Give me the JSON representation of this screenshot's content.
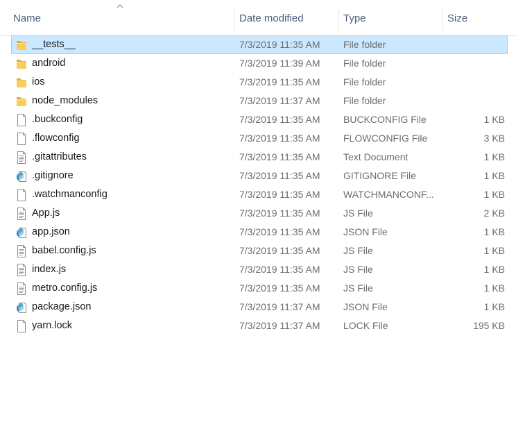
{
  "columns": {
    "name": "Name",
    "date": "Date modified",
    "type": "Type",
    "size": "Size"
  },
  "files": [
    {
      "name": "__tests__",
      "date": "7/3/2019 11:35 AM",
      "type": "File folder",
      "size": "",
      "icon": "folder-icon",
      "selected": true
    },
    {
      "name": "android",
      "date": "7/3/2019 11:39 AM",
      "type": "File folder",
      "size": "",
      "icon": "folder-icon"
    },
    {
      "name": "ios",
      "date": "7/3/2019 11:35 AM",
      "type": "File folder",
      "size": "",
      "icon": "folder-icon"
    },
    {
      "name": "node_modules",
      "date": "7/3/2019 11:37 AM",
      "type": "File folder",
      "size": "",
      "icon": "folder-icon"
    },
    {
      "name": ".buckconfig",
      "date": "7/3/2019 11:35 AM",
      "type": "BUCKCONFIG File",
      "size": "1 KB",
      "icon": "blank-file-icon"
    },
    {
      "name": ".flowconfig",
      "date": "7/3/2019 11:35 AM",
      "type": "FLOWCONFIG File",
      "size": "3 KB",
      "icon": "blank-file-icon"
    },
    {
      "name": ".gitattributes",
      "date": "7/3/2019 11:35 AM",
      "type": "Text Document",
      "size": "1 KB",
      "icon": "text-file-icon"
    },
    {
      "name": ".gitignore",
      "date": "7/3/2019 11:35 AM",
      "type": "GITIGNORE File",
      "size": "1 KB",
      "icon": "editor-file-icon"
    },
    {
      "name": ".watchmanconfig",
      "date": "7/3/2019 11:35 AM",
      "type": "WATCHMANCONF...",
      "size": "1 KB",
      "icon": "blank-file-icon"
    },
    {
      "name": "App.js",
      "date": "7/3/2019 11:35 AM",
      "type": "JS File",
      "size": "2 KB",
      "icon": "text-file-icon"
    },
    {
      "name": "app.json",
      "date": "7/3/2019 11:35 AM",
      "type": "JSON File",
      "size": "1 KB",
      "icon": "editor-file-icon"
    },
    {
      "name": "babel.config.js",
      "date": "7/3/2019 11:35 AM",
      "type": "JS File",
      "size": "1 KB",
      "icon": "text-file-icon"
    },
    {
      "name": "index.js",
      "date": "7/3/2019 11:35 AM",
      "type": "JS File",
      "size": "1 KB",
      "icon": "text-file-icon"
    },
    {
      "name": "metro.config.js",
      "date": "7/3/2019 11:35 AM",
      "type": "JS File",
      "size": "1 KB",
      "icon": "text-file-icon"
    },
    {
      "name": "package.json",
      "date": "7/3/2019 11:37 AM",
      "type": "JSON File",
      "size": "1 KB",
      "icon": "editor-file-icon"
    },
    {
      "name": "yarn.lock",
      "date": "7/3/2019 11:37 AM",
      "type": "LOCK File",
      "size": "195 KB",
      "icon": "blank-file-icon"
    }
  ],
  "colors": {
    "selection_bg": "#cce8ff",
    "selection_border": "#99d1ff",
    "folder": "#f5c242",
    "header_text": "#4c607a"
  }
}
